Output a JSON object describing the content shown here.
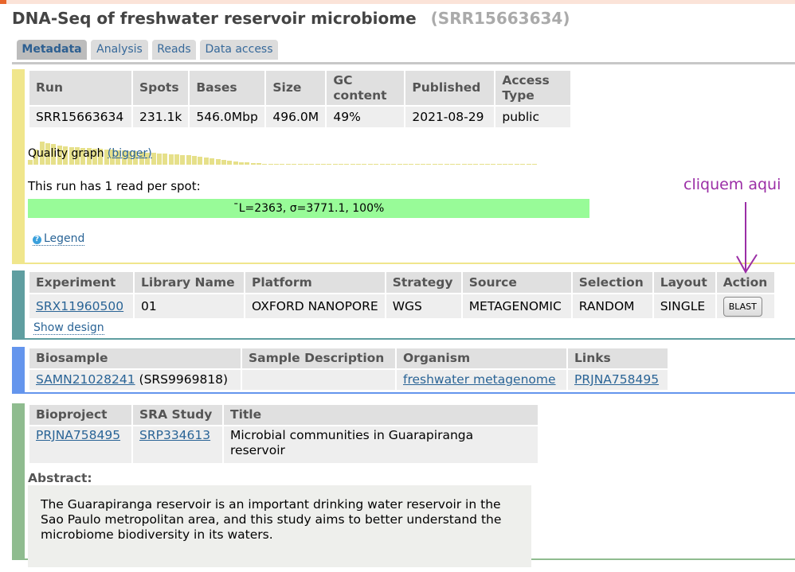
{
  "header": {
    "title": "DNA-Seq of freshwater reservoir microbiome",
    "accession": "(SRR15663634)"
  },
  "tabs": [
    {
      "label": "Metadata",
      "active": true
    },
    {
      "label": "Analysis",
      "active": false
    },
    {
      "label": "Reads",
      "active": false
    },
    {
      "label": "Data access",
      "active": false
    }
  ],
  "run": {
    "headers": [
      "Run",
      "Spots",
      "Bases",
      "Size",
      "GC content",
      "Published",
      "Access Type"
    ],
    "gc_header_line1": "GC",
    "gc_header_line2": "content",
    "access_header_line1": "Access",
    "access_header_line2": "Type",
    "row": [
      "SRR15663634",
      "231.1k",
      "546.0Mbp",
      "496.0M",
      "49%",
      "2021-08-29",
      "public"
    ],
    "quality_graph_label": "Quality graph",
    "quality_graph_link": "(bigger)",
    "quality_graph_levels": [
      0.2,
      0.6,
      0.9,
      0.85,
      0.8,
      0.75,
      0.72,
      0.7,
      0.68,
      0.66,
      0.65,
      0.63,
      0.62,
      0.6,
      0.58,
      0.57,
      0.55,
      0.53,
      0.52,
      0.5,
      0.48,
      0.47,
      0.45,
      0.44,
      0.42,
      0.4,
      0.38,
      0.36,
      0.33,
      0.3,
      0.27,
      0.24,
      0.22,
      0.18,
      0.15,
      0.12,
      0.1,
      0.08,
      0.06,
      0.05,
      0.04,
      0.04,
      0.03,
      0.03,
      0.03,
      0.03,
      0.03,
      0.03,
      0.03,
      0.03,
      0.03,
      0.03,
      0.03,
      0.03,
      0.03,
      0.03,
      0.03,
      0.03,
      0.03,
      0.03,
      0.03,
      0.03,
      0.03,
      0.03,
      0.03,
      0.03,
      0.03,
      0.03,
      0.03,
      0.03,
      0.03,
      0.03,
      0.03,
      0.03,
      0.03,
      0.03,
      0.03,
      0.03,
      0.03,
      0.03,
      0.03,
      0.03,
      0.03,
      0.03,
      0.03,
      0.03,
      0.03
    ],
    "read_text": "This run has 1 read per spot:",
    "read_summary": "¯L=2363, σ=3771.1, 100%",
    "legend_icon": "question-icon",
    "legend_label": "Legend",
    "accent_color": "#f0e68c"
  },
  "experiment": {
    "headers": [
      "Experiment",
      "Library Name",
      "Platform",
      "Strategy",
      "Source",
      "Selection",
      "Layout",
      "Action"
    ],
    "row": {
      "experiment": "SRX11960500",
      "library_name": "01",
      "platform": "OXFORD NANOPORE",
      "strategy": "WGS",
      "source": "METAGENOMIC",
      "selection": "RANDOM",
      "layout": "SINGLE",
      "action": "BLAST"
    },
    "show_design": "Show design",
    "accent_color": "#5f9ea0"
  },
  "biosample": {
    "headers": [
      "Biosample",
      "Sample Description",
      "Organism",
      "Links"
    ],
    "row": {
      "biosample": "SAMN21028241",
      "biosample_extra": " (SRS9969818)",
      "description": "",
      "organism": "freshwater metagenome",
      "links": "PRJNA758495"
    },
    "accent_color": "#6495ed"
  },
  "bioproject": {
    "headers": [
      "Bioproject",
      "SRA Study",
      "Title"
    ],
    "row": {
      "bioproject": "PRJNA758495",
      "sra_study": "SRP334613",
      "title_line1": "Microbial communities in Guarapiranga",
      "title_line2": "reservoir"
    },
    "abstract_label": "Abstract:",
    "abstract_line1": "The Guarapiranga reservoir is an important drinking water reservoir in the",
    "abstract_line2": "Sao Paulo metropolitan area, and this study aims to better understand the",
    "abstract_line3": "microbiome biodiversity in its waters.",
    "accent_color": "#8fbc8f"
  },
  "annotation": {
    "text": "cliquem aqui",
    "color": "#9b2ea6"
  }
}
